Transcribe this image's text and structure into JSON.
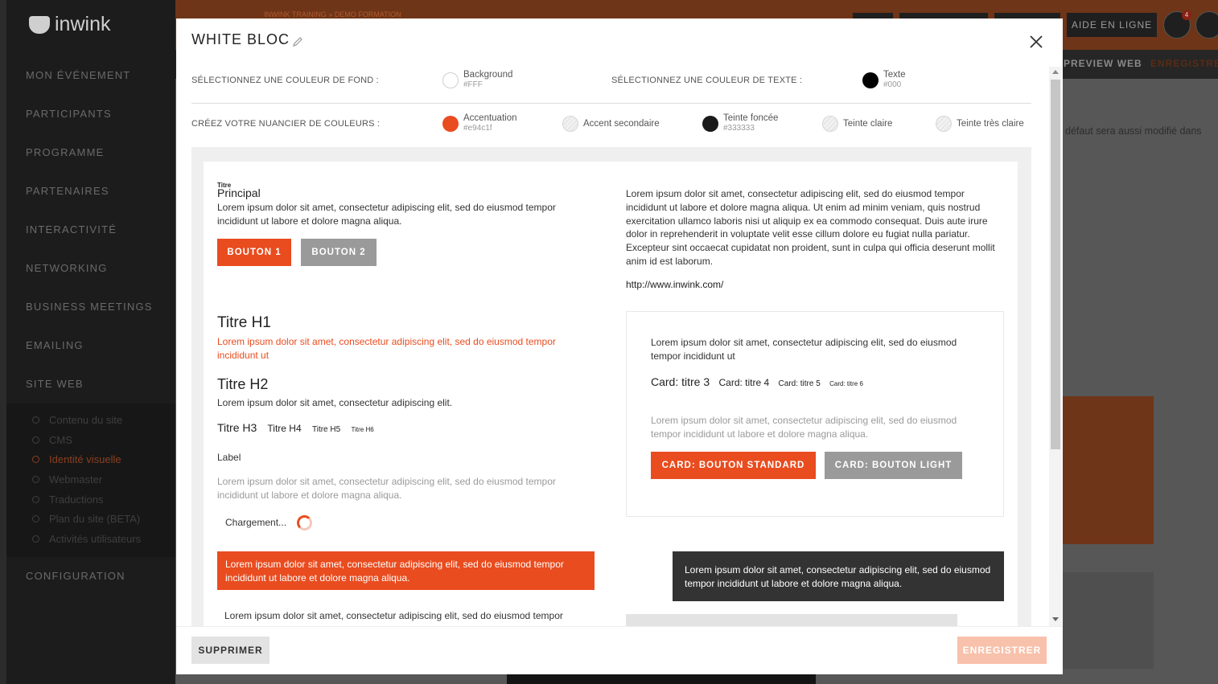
{
  "app": {
    "logo": "inwink",
    "breadcrumb": "INWINK TRAINING » DEMO FORMATION",
    "help_label": "AIDE EN LIGNE",
    "notif_count": "4",
    "preview_web": "PREVIEW WEB",
    "save_top": "ENREGISTRER",
    "bg_note": "défaut sera aussi modifié dans"
  },
  "sidebar": {
    "items": [
      {
        "label": "MON ÉVÉNEMENT"
      },
      {
        "label": "PARTICIPANTS"
      },
      {
        "label": "PROGRAMME"
      },
      {
        "label": "PARTENAIRES"
      },
      {
        "label": "INTERACTIVITÉ"
      },
      {
        "label": "NETWORKING"
      },
      {
        "label": "BUSINESS MEETINGS"
      },
      {
        "label": "EMAILING"
      },
      {
        "label": "SITE WEB"
      }
    ],
    "sub_items": [
      {
        "label": "Contenu du site"
      },
      {
        "label": "CMS"
      },
      {
        "label": "Identité visuelle"
      },
      {
        "label": "Webmaster"
      },
      {
        "label": "Traductions"
      },
      {
        "label": "Plan du site (BETA)"
      },
      {
        "label": "Activités utilisateurs"
      }
    ],
    "config": "CONFIGURATION"
  },
  "modal": {
    "title": "WHITE BLOC",
    "bg_color_label": "SÉLECTIONNEZ UNE COULEUR DE FOND :",
    "bg_swatch": {
      "name": "Background",
      "hex": "#FFF"
    },
    "text_color_label": "SÉLECTIONNEZ UNE COULEUR DE TEXTE :",
    "text_swatch": {
      "name": "Texte",
      "hex": "#000"
    },
    "palette_label": "CRÉEZ VOTRE NUANCIER DE COULEURS :",
    "palette": [
      {
        "name": "Accentuation",
        "hex": "#e94c1f"
      },
      {
        "name": "Accent secondaire",
        "hex": ""
      },
      {
        "name": "Teinte foncée",
        "hex": "#333333"
      },
      {
        "name": "Teinte claire",
        "hex": ""
      },
      {
        "name": "Teinte très claire",
        "hex": ""
      }
    ],
    "delete_label": "SUPPRIMER",
    "save_label": "ENREGISTRER"
  },
  "preview": {
    "title_small": "Titre",
    "title_main": "Principal",
    "intro": "Lorem ipsum dolor sit amet, consectetur adipiscing elit, sed do eiusmod tempor incididunt ut labore et dolore magna aliqua.",
    "button1": "BOUTON 1",
    "button2": "BOUTON 2",
    "right_paragraph": "Lorem ipsum dolor sit amet, consectetur adipiscing elit, sed do eiusmod tempor incididunt ut labore et dolore magna aliqua. Ut enim ad minim veniam, quis nostrud exercitation ullamco laboris nisi ut aliquip ex ea commodo consequat. Duis aute irure dolor in reprehenderit in voluptate velit esse cillum dolore eu fugiat nulla pariatur. Excepteur sint occaecat cupidatat non proident, sunt in culpa qui officia deserunt mollit anim id est laborum.",
    "link": "http://www.inwink.com/",
    "h1": "Titre H1",
    "h1_text": "Lorem ipsum dolor sit amet, consectetur adipiscing elit, sed do eiusmod tempor incididunt ut",
    "h2": "Titre H2",
    "h2_text": "Lorem ipsum dolor sit amet, consectetur adipiscing elit.",
    "h3": "Titre H3",
    "h4": "Titre H4",
    "h5": "Titre H5",
    "h6": "Titre H6",
    "label": "Label",
    "muted_text": "Lorem ipsum dolor sit amet, consectetur adipiscing elit, sed do eiusmod tempor incididunt ut labore et dolore magna aliqua.",
    "loading": "Chargement...",
    "accent_box": "Lorem ipsum dolor sit amet, consectetur adipiscing elit, sed do eiusmod tempor incididunt ut labore et dolore magna aliqua.",
    "bottom_text": "Lorem ipsum dolor sit amet, consectetur adipiscing elit, sed do eiusmod tempor",
    "dark_box": "Lorem ipsum dolor sit amet, consectetur adipiscing elit, sed do eiusmod tempor incididunt ut labore et dolore magna aliqua.",
    "card": {
      "text": "Lorem ipsum dolor sit amet, consectetur adipiscing elit, sed do eiusmod tempor incididunt ut",
      "title3": "Card: titre 3",
      "title4": "Card: titre 4",
      "title5": "Card: titre 5",
      "title6": "Card: titre 6",
      "muted": "Lorem ipsum dolor sit amet, consectetur adipiscing elit, sed do eiusmod tempor incididunt ut labore et dolore magna aliqua.",
      "btn_standard": "CARD: BOUTON STANDARD",
      "btn_light": "CARD: BOUTON LIGHT"
    }
  },
  "colors": {
    "accent": "#e94c1f",
    "dark": "#333333",
    "save_disabled": "#f8c1ab"
  }
}
